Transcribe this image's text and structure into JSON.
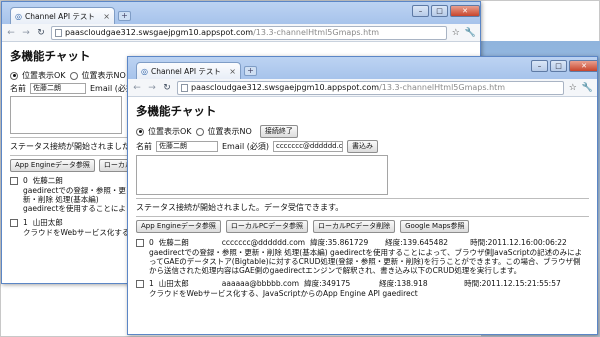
{
  "back_window": {
    "tab_title": "Channel API テスト",
    "url_host": "paascloudgae312.swsgaejpgm10.appspot.com",
    "url_path": "/13.3-channelHtml5Gmaps.htm",
    "heading": "多機能チャット",
    "radio_ok": "位置表示OK",
    "radio_no": "位置表示NO",
    "name_label": "名前",
    "name_value": "佐藤二朗",
    "email_label": "Email (必須)",
    "status": "ステータス接続が開始されました。データ受信できます。",
    "buttons": [
      "App Engineデータ参照",
      "ローカルPCデータ参照"
    ],
    "messages": [
      {
        "idx": "0",
        "name": "佐藤二朗",
        "text": "gaedirectでの登録・参照・更新・削除 処理(基本編) gaedirectを使用することによって、ブラウザ側JavaScriptの記述のみによってGAEのデータストア(Bigtable)に対するCRUD処理(登録・参照・更新・削除)を行うことができます。この場合、ブラウザ側から送信された処理内容はGAE側のgaedirectエンジンで解釈され、書き込み以下のCRUD処理を実行します。"
      },
      {
        "idx": "1",
        "name": "山田太郎",
        "text": "クラウドをWebサービス化する、JavaScriptからのApp Engine API gaedirect"
      }
    ]
  },
  "front_window": {
    "tab_title": "Channel API テスト",
    "url_host": "paascloudgae312.swsgaejpgm10.appspot.com",
    "url_path": "/13.3-channelHtml5Gmaps.htm",
    "heading": "多機能チャット",
    "radio_ok": "位置表示OK",
    "radio_no": "位置表示NO",
    "end_button": "接続終了",
    "name_label": "名前",
    "name_value": "佐藤二朗",
    "email_label": "Email (必須)",
    "email_value": "ccccccc@dddddd.com",
    "write_button": "書込み",
    "status": "ステータス接続が開始されました。データ受信できます。",
    "buttons": [
      "App Engineデータ参照",
      "ローカルPCデータ参照",
      "ローカルPCデータ削除",
      "Google Maps参照"
    ],
    "messages": [
      {
        "idx": "0",
        "name": "佐藤二朗",
        "email": "ccccccc@dddddd.com",
        "lat": "緯度:35.861729",
        "lng": "経度:139.645482",
        "time": "時間:2011.12.16:00:06:22",
        "text": "gaedirectでの登録・参照・更新・削除 処理(基本編) gaedirectを使用することによって、ブラウザ側JavaScriptの記述のみによってGAEのデータストア(Bigtable)に対するCRUD処理(登録・参照・更新・削除)を行うことができます。この場合、ブラウザ側から送信された処理内容はGAE側のgaedirectエンジンで解釈され、書き込み以下のCRUD処理を実行します。"
      },
      {
        "idx": "1",
        "name": "山田太郎",
        "email": "aaaaaa@bbbbb.com",
        "lat": "緯度:349175",
        "lng": "経度:138.918",
        "time": "時間:2011.12.15:21:55:57",
        "text": "クラウドをWebサービス化する、JavaScriptからのApp Engine API gaedirect"
      }
    ]
  },
  "icons": {
    "back": "back-arrow-icon",
    "forward": "forward-arrow-icon",
    "reload": "reload-icon",
    "star": "star-icon",
    "wrench": "wrench-icon",
    "globe": "globe-icon"
  }
}
